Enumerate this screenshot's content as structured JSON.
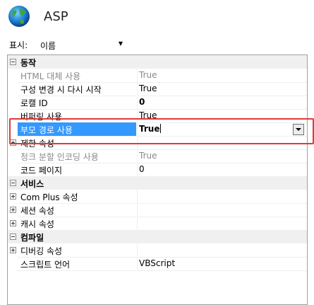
{
  "header": {
    "title": "ASP",
    "icon": "globe-icon"
  },
  "toolbar": {
    "view_label": "표시:",
    "view_value": "이름"
  },
  "grid": {
    "categories": {
      "behavior": "동작",
      "services": "서비스",
      "compilation": "컴파일"
    },
    "rows": {
      "html_fallback": {
        "name": "HTML 대체 사용",
        "value": "True"
      },
      "restart_on_config": {
        "name": "구성 변경 시 다시 시작",
        "value": "True"
      },
      "locale_id": {
        "name": "로캘 ID",
        "value": "0"
      },
      "buffering": {
        "name": "버퍼링 사용",
        "value": "True"
      },
      "parent_paths": {
        "name": "부모 경로 사용",
        "value": "True"
      },
      "limits": {
        "name": "제한 속성"
      },
      "chunked_encoding": {
        "name": "청크 분할 인코딩 사용",
        "value": "True"
      },
      "code_page": {
        "name": "코드 페이지",
        "value": "0"
      },
      "com_plus": {
        "name": "Com Plus 속성"
      },
      "session": {
        "name": "세션 속성"
      },
      "cache": {
        "name": "캐시 속성"
      },
      "debugging": {
        "name": "디버깅 속성"
      },
      "script_language": {
        "name": "스크립트 언어",
        "value": "VBScript"
      }
    }
  },
  "colors": {
    "selection": "#3399ff",
    "highlight_border": "#e03a3a"
  }
}
